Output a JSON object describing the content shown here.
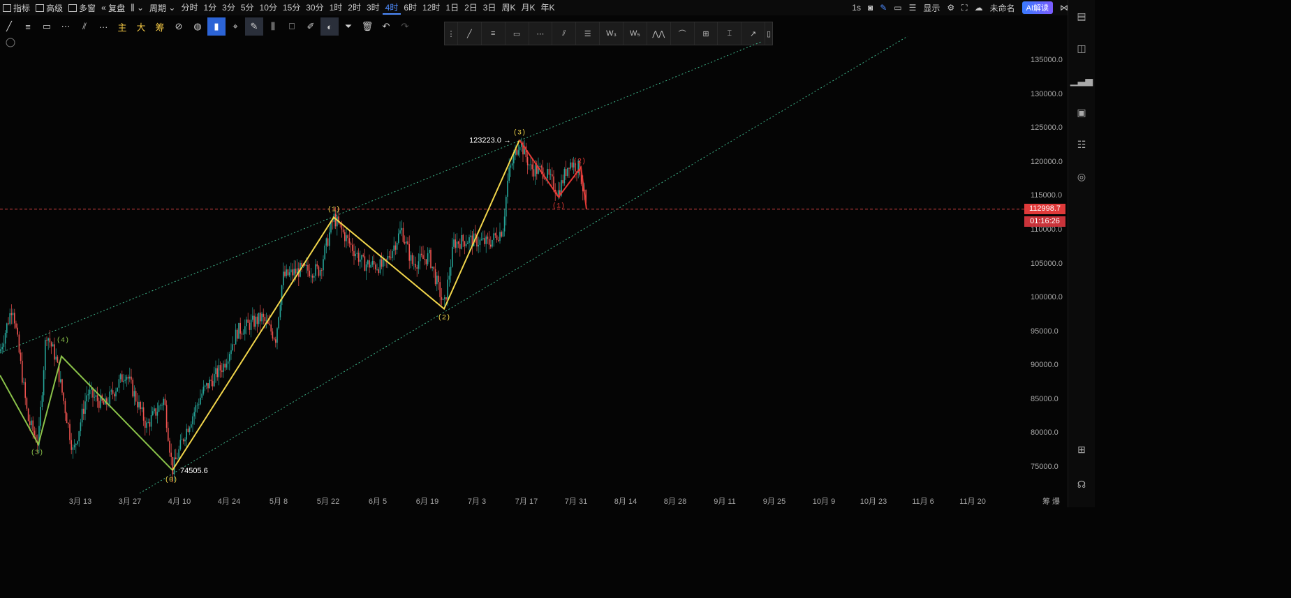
{
  "topbar": {
    "indicator_label": "指标",
    "advanced_label": "高级",
    "multiwindow_label": "多窗",
    "replay_label": "复盘",
    "period_label": "周期",
    "periods": [
      "分时",
      "1分",
      "3分",
      "5分",
      "10分",
      "15分",
      "30分",
      "1时",
      "2时",
      "3时",
      "4时",
      "6时",
      "12时",
      "1日",
      "2日",
      "3日",
      "周K",
      "月K",
      "年K"
    ],
    "active_period": "4时",
    "interval": "1s",
    "display_label": "显示",
    "unnamed_label": "未命名",
    "ai_label": "AI解读"
  },
  "toolbar": {
    "tools": [
      "line-tool",
      "hline-tool",
      "rect-tool",
      "fib-tool",
      "parallel-tool",
      "more-tool"
    ],
    "zhu": "主",
    "da": "大",
    "chou": "筹"
  },
  "chart_data": {
    "type": "candlestick",
    "yaxis_ticks": [
      135000,
      130000,
      125000,
      120000,
      115000,
      110000,
      105000,
      100000,
      95000,
      90000,
      85000,
      80000,
      75000
    ],
    "xaxis_ticks": [
      "3月 13",
      "3月 27",
      "4月 10",
      "4月 24",
      "5月 8",
      "5月 22",
      "6月 5",
      "6月 19",
      "7月 3",
      "7月 17",
      "7月 31",
      "8月 14",
      "8月 28",
      "9月 11",
      "9月 25",
      "10月 9",
      "10月 23",
      "11月 6",
      "11月 20"
    ],
    "current_price": "112998.7",
    "countdown": "01:16:26",
    "annotations": {
      "high": "123223.0",
      "low": "74505.6"
    },
    "wave_labels": {
      "green": [
        "(4)",
        "(3)"
      ],
      "yellow": [
        "(0)",
        "(1)",
        "(2)",
        "(3)"
      ],
      "red": [
        "(1)",
        "(2)"
      ]
    },
    "colors": {
      "up": "#26a69a",
      "down": "#ef5350",
      "wave_yellow": "#f2d64b",
      "wave_green": "#8bc34a",
      "wave_red": "#e53935",
      "channel": "#3fb68b"
    }
  },
  "xaxis_right": "筹  爆"
}
